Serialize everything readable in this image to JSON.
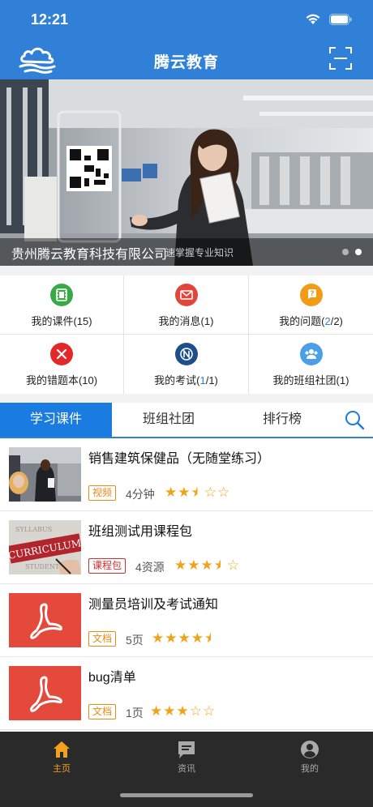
{
  "status_bar": {
    "time": "12:21"
  },
  "header": {
    "title": "腾云教育"
  },
  "banner": {
    "company": "贵州腾云教育科技有限公司",
    "subtitle": "速掌握专业知识",
    "dots": 2,
    "active_dot": 1
  },
  "grid": [
    {
      "label_main": "我的课件(15)",
      "icon": "film-icon",
      "color": "#3aa845"
    },
    {
      "label_main": "我的消息(1)",
      "icon": "envelope-icon",
      "color": "#e2453c"
    },
    {
      "label_prefix": "我的问题(",
      "label_hl": "2",
      "label_suffix": "/2)",
      "icon": "question-icon",
      "color": "#f29b17"
    },
    {
      "label_main": "我的错题本(10)",
      "icon": "wrong-x-icon",
      "color": "#e3282a"
    },
    {
      "label_prefix": "我的考试(",
      "label_hl": "1",
      "label_suffix": "/1)",
      "icon": "exam-icon",
      "color": "#1d4f8a"
    },
    {
      "label_main": "我的班组社团(1)",
      "icon": "group-icon",
      "color": "#4a9fe6"
    }
  ],
  "tabs": {
    "items": [
      "学习课件",
      "班组社团",
      "排行榜"
    ],
    "active": 0
  },
  "list": [
    {
      "title": "销售建筑保健品（无随堂练习）",
      "badge": "视频",
      "badge_type": "video",
      "meta": "4分钟",
      "rating": 2.5
    },
    {
      "title": "班组测试用课程包",
      "badge": "课程包",
      "badge_type": "pack",
      "meta": "4资源",
      "rating": 3.5,
      "thumb_text": "CURRICULUM"
    },
    {
      "title": "测量员培训及考试通知",
      "badge": "文档",
      "badge_type": "doc",
      "meta": "5页",
      "rating": 4.5
    },
    {
      "title": "bug清单",
      "badge": "文档",
      "badge_type": "doc",
      "meta": "1页",
      "rating": 3
    }
  ],
  "bottom_nav": [
    {
      "label": "主页",
      "icon": "home-icon",
      "active": true
    },
    {
      "label": "资讯",
      "icon": "news-icon",
      "active": false
    },
    {
      "label": "我的",
      "icon": "profile-icon",
      "active": false
    }
  ],
  "colors": {
    "primary": "#2f80d6",
    "tab_active": "#1a7be0",
    "star": "#f0a31a",
    "nav_active": "#f2a11e"
  }
}
